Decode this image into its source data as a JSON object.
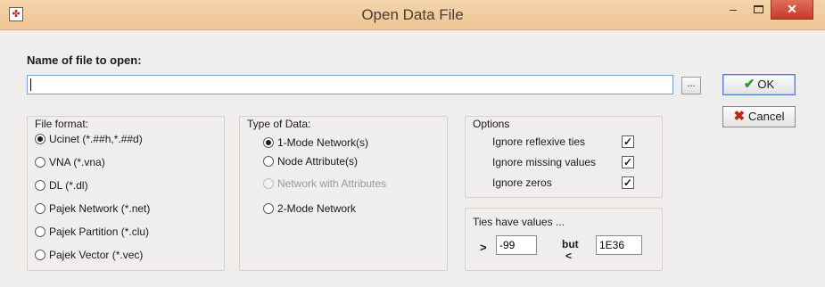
{
  "window": {
    "title": "Open Data File",
    "app_icon": "ucinet-app-icon",
    "minimize_glyph": "–",
    "close_glyph": "✕"
  },
  "file": {
    "label": "Name of file to open:",
    "value": "",
    "browse_label": "..."
  },
  "buttons": {
    "ok_label": "OK",
    "ok_icon": "green-checkmark-icon",
    "cancel_label": "Cancel",
    "cancel_icon": "red-x-icon"
  },
  "file_format": {
    "title": "File format:",
    "options": [
      {
        "label": "Ucinet (*.##h,*.##d)",
        "selected": true
      },
      {
        "label": "VNA (*.vna)",
        "selected": false
      },
      {
        "label": "DL (*.dl)",
        "selected": false
      },
      {
        "label": "Pajek Network (*.net)",
        "selected": false
      },
      {
        "label": "Pajek Partition (*.clu)",
        "selected": false
      },
      {
        "label": "Pajek Vector (*.vec)",
        "selected": false
      }
    ]
  },
  "type_of_data": {
    "title": "Type of Data:",
    "options": [
      {
        "label": "1-Mode Network(s)",
        "selected": true,
        "enabled": true
      },
      {
        "label": "Node Attribute(s)",
        "selected": false,
        "enabled": true
      },
      {
        "label": "Network with Attributes",
        "selected": false,
        "enabled": false
      },
      {
        "label": "2-Mode Network",
        "selected": false,
        "enabled": true
      }
    ]
  },
  "options": {
    "title": "Options",
    "items": [
      {
        "label": "Ignore reflexive ties",
        "checked": true
      },
      {
        "label": "Ignore missing values",
        "checked": true
      },
      {
        "label": "Ignore zeros",
        "checked": true
      }
    ]
  },
  "ties": {
    "title": "Ties have values ...",
    "gt_sign": ">",
    "low_value": "-99",
    "but_label": "but",
    "lt_sign": "<",
    "high_value": "1E36"
  }
}
